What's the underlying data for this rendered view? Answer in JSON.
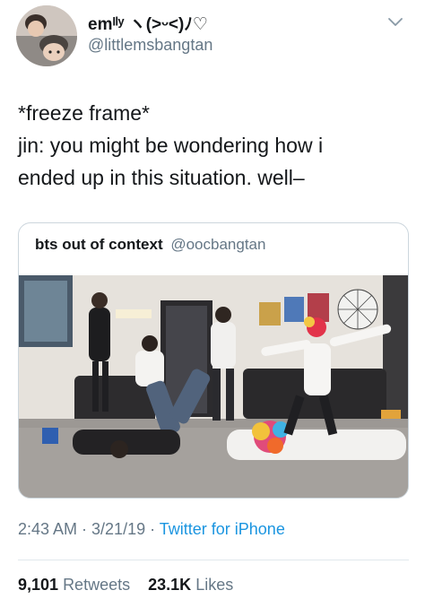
{
  "tweet": {
    "display_name": "emᴵˡʸ ヽ(˃ᵕ˂)ﾉ♡",
    "handle": "@littlemsbangtan",
    "text_lines": [
      "*freeze frame*",
      "jin: you might be wondering how i",
      "ended up in this situation. well–"
    ],
    "timestamp": "2:43 AM · 3/21/19 · ",
    "source": "Twitter for iPhone",
    "retweets_count": "9,101",
    "retweets_label": "Retweets",
    "likes_count": "23.1K",
    "likes_label": "Likes"
  },
  "quoted_tweet": {
    "display_name": "bts out of context",
    "handle": "@oocbangtan",
    "image_alt": "photo"
  },
  "icons": {
    "avatar": "user-avatar-photo",
    "menu": "chevron-down-icon"
  }
}
